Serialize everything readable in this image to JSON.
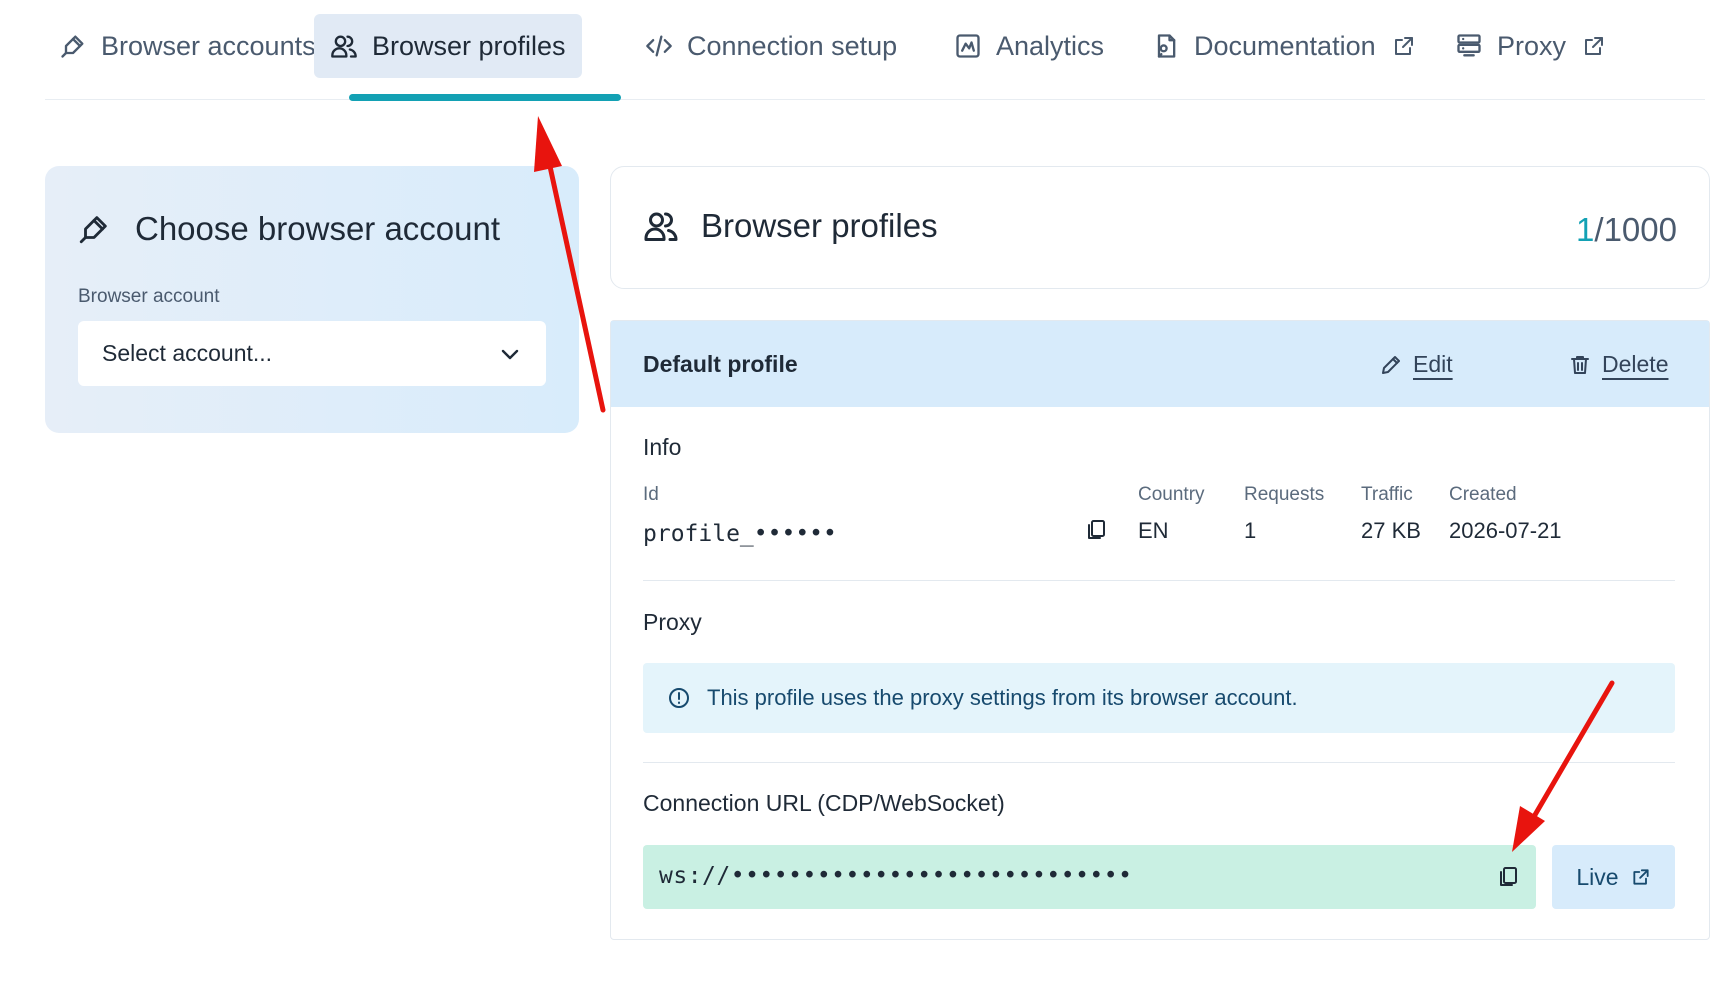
{
  "nav": {
    "tabs": [
      {
        "label": "Browser accounts",
        "icon": "pen-tool-icon"
      },
      {
        "label": "Browser profiles",
        "icon": "users-icon",
        "active": true
      },
      {
        "label": "Connection setup",
        "icon": "code-icon"
      },
      {
        "label": "Analytics",
        "icon": "chart-icon"
      },
      {
        "label": "Documentation",
        "icon": "document-icon",
        "external": true
      },
      {
        "label": "Proxy",
        "icon": "server-icon",
        "external": true
      }
    ]
  },
  "account_panel": {
    "title": "Choose browser account",
    "field_label": "Browser account",
    "select_value": "Select account..."
  },
  "profiles_header": {
    "title": "Browser profiles",
    "count_current": "1",
    "count_total": "/1000"
  },
  "profile": {
    "name": "Default profile",
    "edit_label": "Edit",
    "delete_label": "Delete",
    "info_title": "Info",
    "columns": {
      "id_label": "Id",
      "id_value": "profile_••••••",
      "country_label": "Country",
      "country_value": "EN",
      "requests_label": "Requests",
      "requests_value": "1",
      "traffic_label": "Traffic",
      "traffic_value": "27 KB",
      "created_label": "Created",
      "created_value": "2026-07-21"
    },
    "proxy_title": "Proxy",
    "proxy_notice": "This profile uses the proxy settings from its browser account.",
    "connection_title": "Connection URL (CDP/WebSocket)",
    "connection_url": "ws://••••••••••••••••••••••••••••",
    "live_label": "Live"
  },
  "colors": {
    "accent": "#13a1b4",
    "annotation_arrow": "#e8140e"
  }
}
